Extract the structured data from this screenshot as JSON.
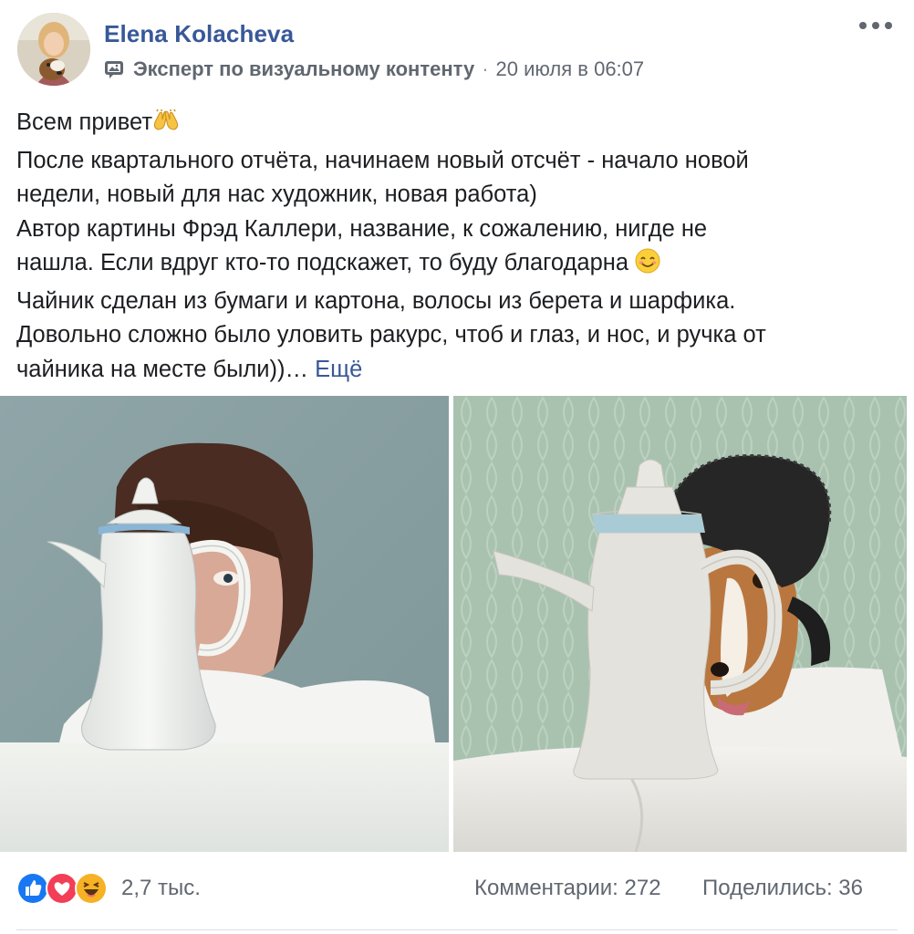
{
  "post": {
    "author": "Elena Kolacheva",
    "badge_label": "Эксперт по визуальному контенту",
    "separator": "·",
    "timestamp": "20 июля в 06:07",
    "text_lines": [
      "Всем привет",
      "После квартального отчёта, начинаем новый отсчёт - начало новой",
      "недели, новый для нас художник, новая работа)",
      "Автор картины Фрэд Каллери, название, к сожалению, нигде не",
      "нашла. Если вдруг кто-то подскажет, то буду благодарна",
      "Чайник сделан из бумаги и картона, волосы из берета и шарфика.",
      "Довольно сложно было уловить ракурс, чтоб и глаз, и нос, и ручка от",
      "чайника на месте были))…"
    ],
    "see_more": "Ещё"
  },
  "icons": {
    "badge": "expert-badge-icon",
    "menu": "more-options-icon",
    "raised_hands": "raising-hands-emoji",
    "smile": "smiling-face-emoji",
    "reactions": [
      "like-reaction-icon",
      "love-reaction-icon",
      "haha-reaction-icon"
    ]
  },
  "footer": {
    "reaction_count": "2,7 тыс.",
    "comments": "Комментарии: 272",
    "shares": "Поделились: 36"
  },
  "colors": {
    "link_blue": "#385898",
    "secondary_text": "#606770",
    "like_blue": "#1877f2",
    "love_red": "#f33e58",
    "haha_yellow": "#f7b125"
  }
}
